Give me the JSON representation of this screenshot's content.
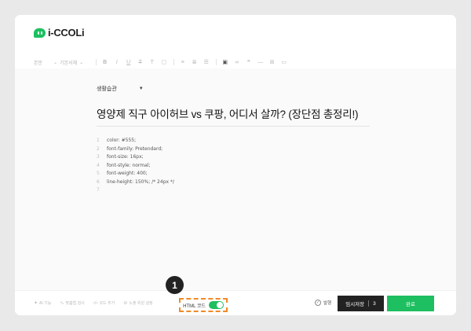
{
  "brand": {
    "logo_text": "i-CCOLi",
    "accent": "#1dbf60",
    "highlight": "#f08a27"
  },
  "toolbar": {
    "format_select": "본문",
    "font_select": "기본서체",
    "buttons": [
      "bold-icon",
      "italic-icon",
      "underline-icon",
      "strikethrough-icon",
      "text-color-icon",
      "highlight-icon",
      "align-left-icon",
      "align-center-icon",
      "list-icon",
      "image-icon",
      "link-icon",
      "quote-icon",
      "divider-icon",
      "table-icon",
      "media-icon"
    ]
  },
  "editor": {
    "category": "생활습관",
    "title": "영양제 직구 아이허브 vs 쿠팡, 어디서 살까? (장단점 총정리!)",
    "code_lines": [
      {
        "num": "1",
        "text": "color: #555;"
      },
      {
        "num": "2",
        "text": "font-family: Pretendard;"
      },
      {
        "num": "3",
        "text": "font-size: 16px;"
      },
      {
        "num": "4",
        "text": "font-style: normal;"
      },
      {
        "num": "5",
        "text": "font-weight: 400;"
      },
      {
        "num": "6",
        "text": "line-height: 150%; /* 24px */"
      },
      {
        "num": "7",
        "text": ""
      }
    ]
  },
  "footer": {
    "tools": [
      {
        "icon": "ai-icon",
        "label": "AI 기능"
      },
      {
        "icon": "spellcheck-icon",
        "label": "맞춤법 검사"
      },
      {
        "icon": "code-icon",
        "label": "코드 추가"
      },
      {
        "icon": "visibility-icon",
        "label": "노출 위원 설정"
      }
    ],
    "html_label": "HTML 코드",
    "html_toggle_on": true,
    "badge": "1",
    "publish_label": "발행",
    "draft_label": "임시저장",
    "draft_count": "3",
    "done_label": "완료"
  }
}
